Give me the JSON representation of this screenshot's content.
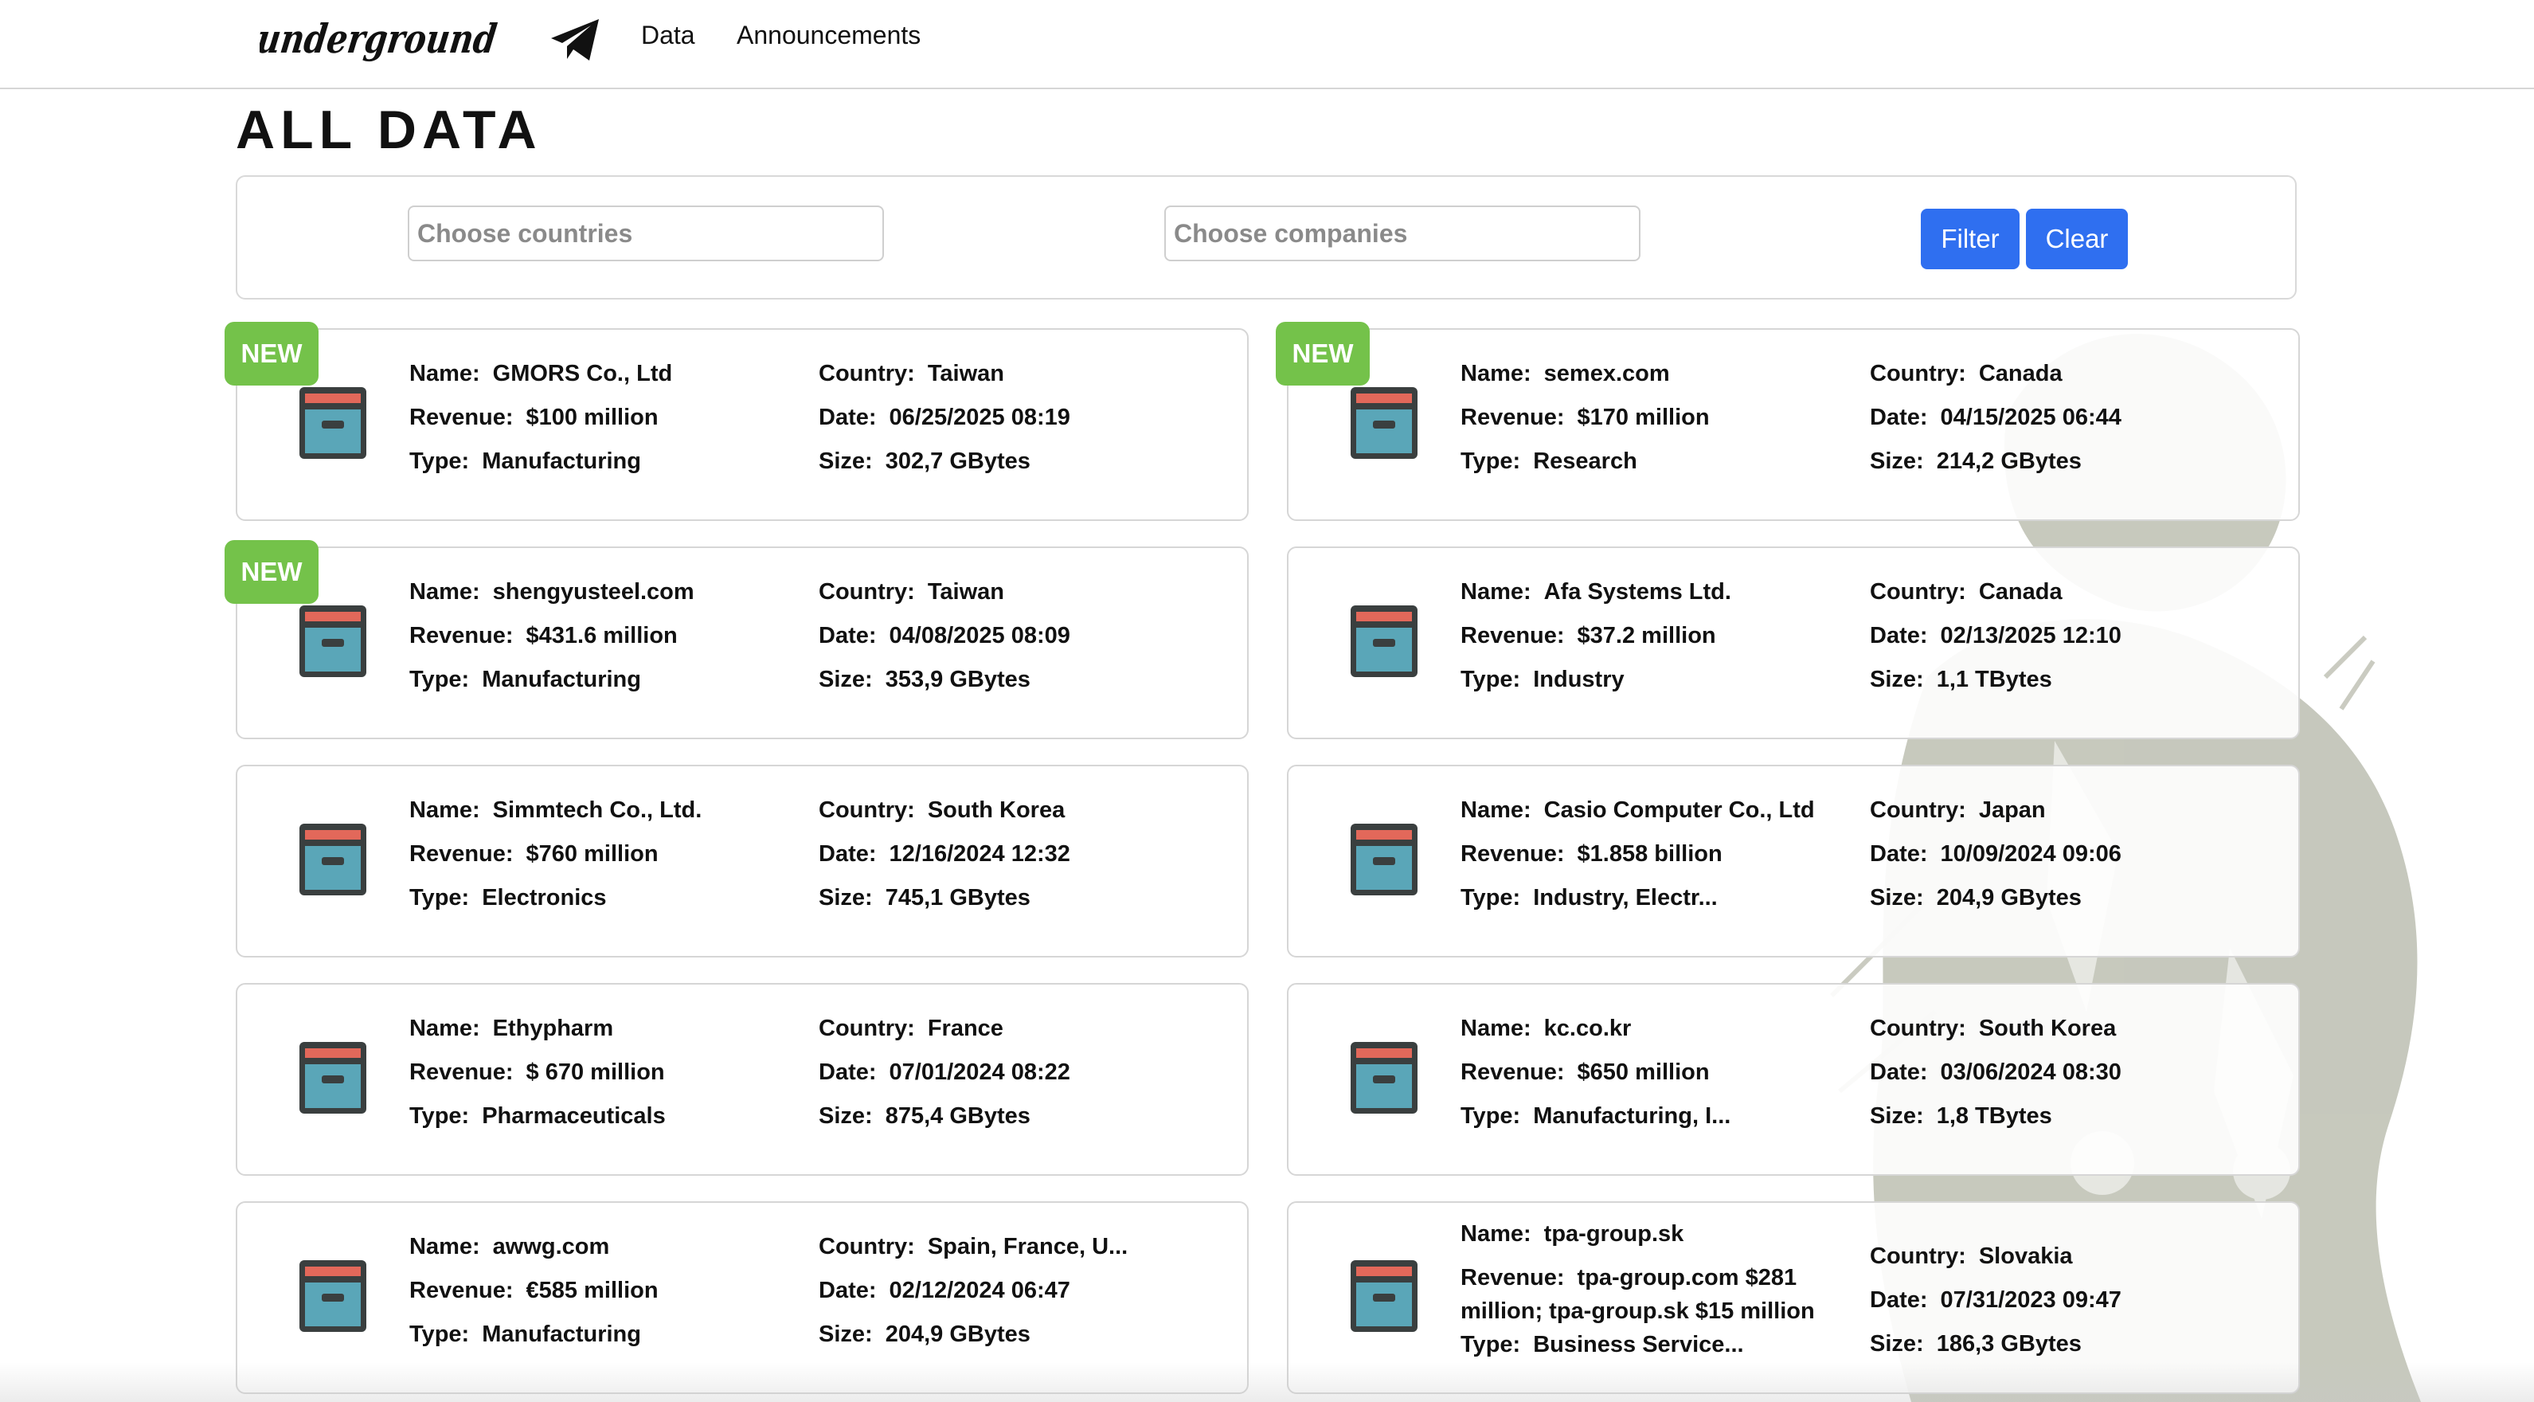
{
  "header": {
    "logo_text": "underground",
    "nav": {
      "data_label": "Data",
      "announcements_label": "Announcements"
    }
  },
  "page_title": "ALL DATA",
  "filters": {
    "countries_placeholder": "Choose countries",
    "companies_placeholder": "Choose companies",
    "filter_label": "Filter",
    "clear_label": "Clear"
  },
  "labels": {
    "name": "Name:",
    "revenue": "Revenue:",
    "type": "Type:",
    "country": "Country:",
    "date": "Date:",
    "size": "Size:",
    "new_badge": "NEW"
  },
  "colors": {
    "accent": "#2f6ff0",
    "new_badge": "#74c24a",
    "box_body": "#5aa6b8",
    "box_lid": "#e2685a",
    "box_outline": "#3a3f3f"
  },
  "cards": [
    {
      "name": "GMORS Co., Ltd",
      "revenue": "$100 million",
      "type": "Manufacturing",
      "country": "Taiwan",
      "date": "06/25/2025 08:19",
      "size": "302,7 GBytes",
      "is_new": true
    },
    {
      "name": "semex.com",
      "revenue": "$170 million",
      "type": "Research",
      "country": "Canada",
      "date": "04/15/2025 06:44",
      "size": "214,2 GBytes",
      "is_new": true
    },
    {
      "name": "shengyusteel.com",
      "revenue": "$431.6 million",
      "type": "Manufacturing",
      "country": "Taiwan",
      "date": "04/08/2025 08:09",
      "size": "353,9 GBytes",
      "is_new": true
    },
    {
      "name": "Afa Systems Ltd.",
      "revenue": "$37.2 million",
      "type": "Industry",
      "country": "Canada",
      "date": "02/13/2025 12:10",
      "size": "1,1 TBytes",
      "is_new": false
    },
    {
      "name": "Simmtech Co., Ltd.",
      "revenue": "$760 million",
      "type": "Electronics",
      "country": "South Korea",
      "date": "12/16/2024 12:32",
      "size": "745,1 GBytes",
      "is_new": false
    },
    {
      "name": "Casio Computer Co., Ltd",
      "revenue": "$1.858 billion",
      "type": "Industry, Electr...",
      "country": "Japan",
      "date": "10/09/2024 09:06",
      "size": "204,9 GBytes",
      "is_new": false
    },
    {
      "name": "Ethypharm",
      "revenue": "$ 670 million",
      "type": "Pharmaceuticals",
      "country": "France",
      "date": "07/01/2024 08:22",
      "size": "875,4 GBytes",
      "is_new": false
    },
    {
      "name": "kc.co.kr",
      "revenue": "$650 million",
      "type": "Manufacturing, I...",
      "country": "South Korea",
      "date": "03/06/2024 08:30",
      "size": "1,8 TBytes",
      "is_new": false
    },
    {
      "name": "awwg.com",
      "revenue": "€585 million",
      "type": "Manufacturing",
      "country": "Spain, France, U...",
      "date": "02/12/2024 06:47",
      "size": "204,9 GBytes",
      "is_new": false
    },
    {
      "name": "tpa-group.sk",
      "revenue": "tpa-group.com $281 million; tpa-group.sk $15 million",
      "type": "Business Service...",
      "country": "Slovakia",
      "date": "07/31/2023 09:47",
      "size": "186,3 GBytes",
      "is_new": false
    }
  ]
}
